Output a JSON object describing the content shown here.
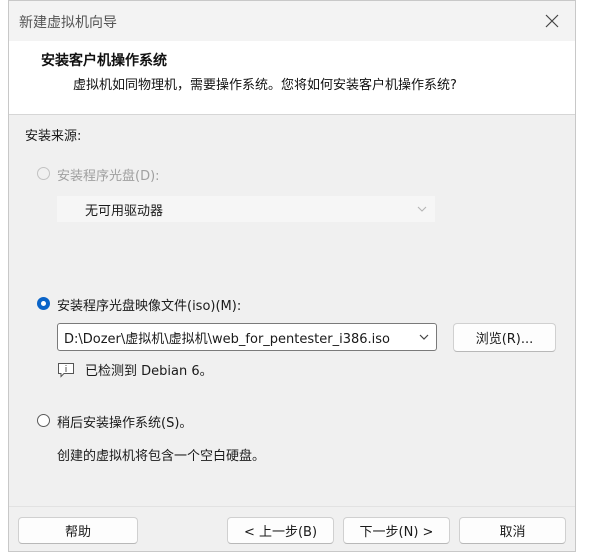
{
  "window": {
    "title": "新建虚拟机向导"
  },
  "header": {
    "title": "安装客户机操作系统",
    "subtitle": "虚拟机如同物理机，需要操作系统。您将如何安装客户机操作系统?"
  },
  "install_source": {
    "label": "安装来源:",
    "disc_option": {
      "label": "安装程序光盘(D):",
      "selected": false,
      "enabled": false,
      "drive_value": "无可用驱动器"
    },
    "iso_option": {
      "label": "安装程序光盘映像文件(iso)(M):",
      "selected": true,
      "enabled": true,
      "path_value": "D:\\Dozer\\虚拟机\\虚拟机\\web_for_pentester_i386.iso",
      "browse_label": "浏览(R)...",
      "detected_text": "已检测到 Debian 6。"
    },
    "later_option": {
      "label": "稍后安装操作系统(S)。",
      "selected": false,
      "description": "创建的虚拟机将包含一个空白硬盘。"
    }
  },
  "footer": {
    "help_label": "帮助",
    "back_label": "< 上一步(B)",
    "next_label": "下一步(N) >",
    "cancel_label": "取消"
  },
  "colors": {
    "accent": "#0a64c8",
    "window_bg": "#f0f0f0",
    "header_bg": "#ffffff"
  },
  "icons": [
    "close-icon",
    "chevron-down-icon",
    "info-icon"
  ]
}
